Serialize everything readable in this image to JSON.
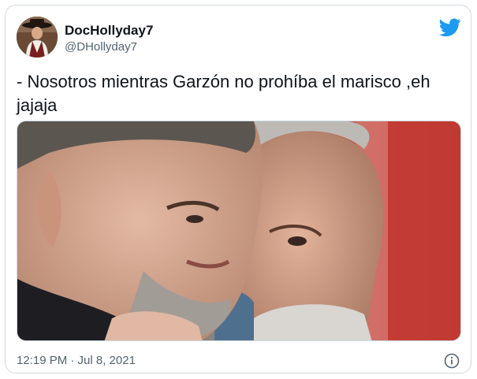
{
  "tweet": {
    "display_name": "DocHollyday7",
    "handle": "@DHollyday7",
    "text": "- Nosotros mientras Garzón no prohíba el marisco ,eh jajaja",
    "timestamp": "12:19 PM · Jul 8, 2021"
  },
  "icons": {
    "brand": "twitter-bird-icon",
    "info": "info-icon"
  },
  "colors": {
    "twitter_blue": "#1d9bf0",
    "text_primary": "#0f1419",
    "text_secondary": "#536471",
    "border": "#cfd9de"
  }
}
